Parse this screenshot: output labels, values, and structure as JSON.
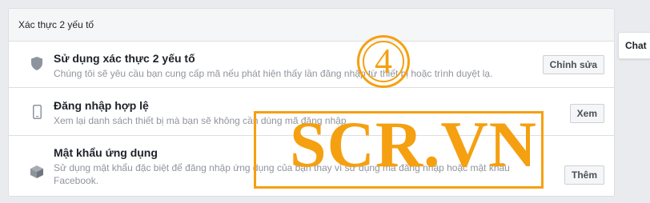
{
  "section": {
    "title": "Xác thực 2 yếu tố"
  },
  "rows": [
    {
      "icon": "shield-icon",
      "title": "Sử dụng xác thực 2 yếu tố",
      "description": "Chúng tôi sẽ yêu cầu bạn cung cấp mã nếu phát hiện thấy lần đăng nhập từ thiết bị hoặc trình duyệt lạ.",
      "button": "Chỉnh sửa"
    },
    {
      "icon": "phone-icon",
      "title": "Đăng nhập hợp lệ",
      "description": "Xem lại danh sách thiết bị mà bạn sẽ không cần dùng mã đăng nhập",
      "button": "Xem"
    },
    {
      "icon": "box-icon",
      "title": "Mật khẩu ứng dụng",
      "description": "Sử dụng mật khẩu đặc biệt để đăng nhập ứng dụng của bạn thay vì sử dụng mã đăng nhập hoặc mật khẩu Facebook.",
      "button": "Thêm"
    }
  ],
  "chat": {
    "label": "Chat"
  },
  "watermark": {
    "step": "4",
    "brand": "SCR.VN",
    "color": "#f5a010"
  }
}
